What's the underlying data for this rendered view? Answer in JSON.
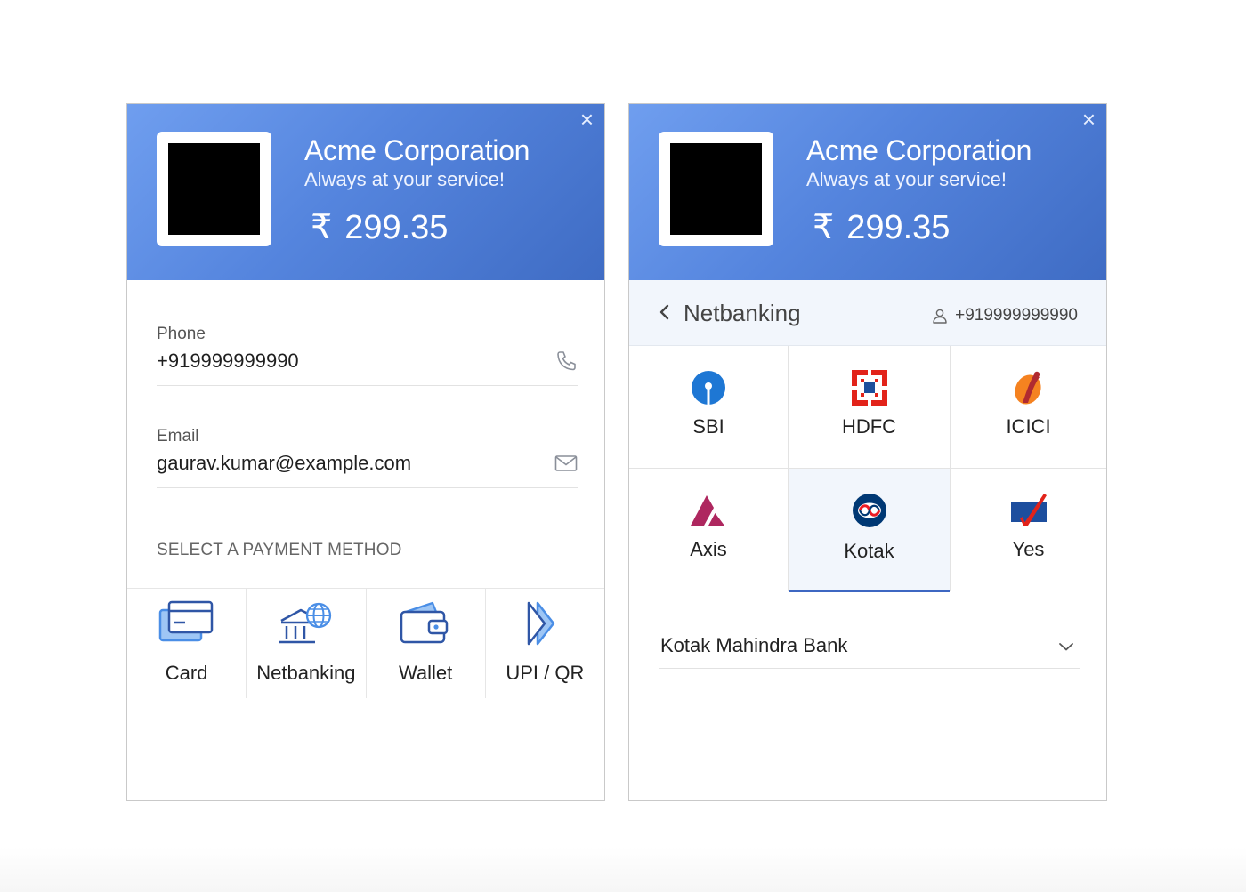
{
  "merchant": {
    "name": "Acme Corporation",
    "tagline": "Always at your service!",
    "currency_symbol": "₹",
    "amount": "299.35"
  },
  "left": {
    "phone_label": "Phone",
    "phone_value": "+919999999990",
    "email_label": "Email",
    "email_value": "gaurav.kumar@example.com",
    "section_title": "SELECT A PAYMENT METHOD",
    "methods": [
      {
        "label": "Card",
        "icon": "card-icon"
      },
      {
        "label": "Netbanking",
        "icon": "netbanking-icon"
      },
      {
        "label": "Wallet",
        "icon": "wallet-icon"
      },
      {
        "label": "UPI / QR",
        "icon": "upi-icon"
      }
    ]
  },
  "right": {
    "bar_title": "Netbanking",
    "contact": "+919999999990",
    "banks": [
      {
        "label": "SBI",
        "icon": "sbi-logo-icon"
      },
      {
        "label": "HDFC",
        "icon": "hdfc-logo-icon"
      },
      {
        "label": "ICICI",
        "icon": "icici-logo-icon"
      },
      {
        "label": "Axis",
        "icon": "axis-logo-icon"
      },
      {
        "label": "Kotak",
        "icon": "kotak-logo-icon"
      },
      {
        "label": "Yes",
        "icon": "yes-logo-icon"
      }
    ],
    "selected_bank": "Kotak",
    "dropdown_value": "Kotak Mahindra Bank"
  },
  "colors": {
    "header_start": "#6f9eef",
    "header_end": "#3f6cc4",
    "accent": "#3d67c2",
    "icon_blue": "#4a8ee6",
    "icon_dark": "#2f56a6"
  },
  "icons": {
    "close": "×",
    "back": "chevron-left-icon",
    "dropdown": "chevron-down-icon",
    "phone": "phone-icon",
    "email": "mail-icon",
    "contact": "user-icon"
  }
}
